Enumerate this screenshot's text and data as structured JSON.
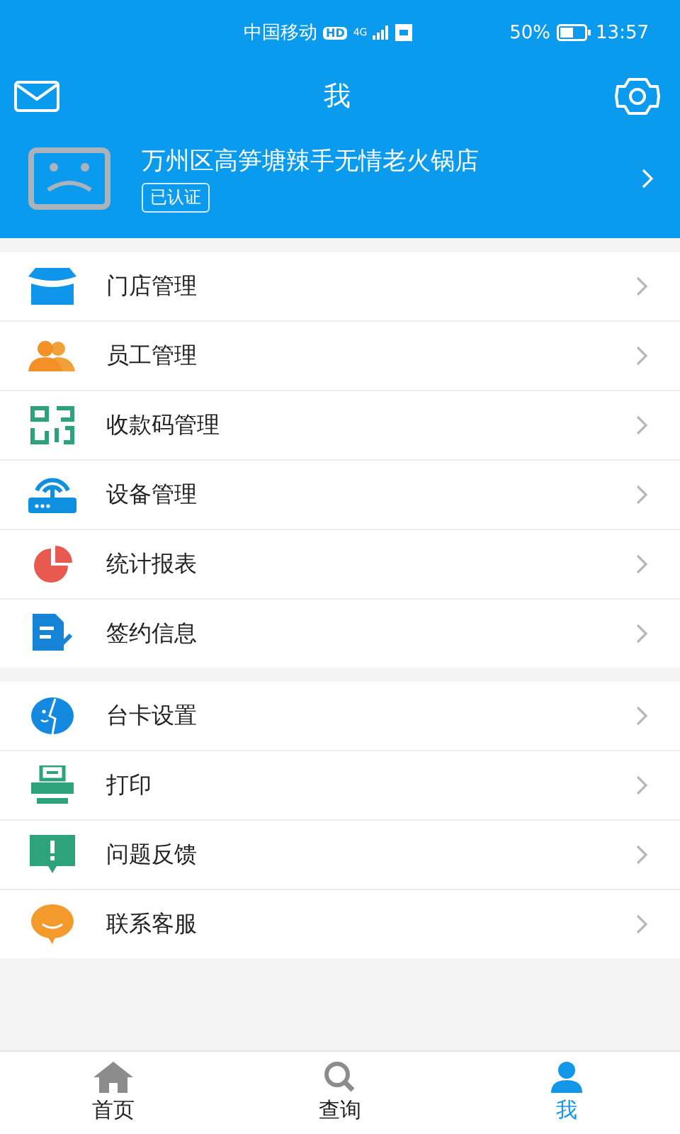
{
  "status_bar": {
    "carrier": "中国移动",
    "hd": "HD",
    "network": "4G",
    "battery": "50%",
    "time": "13:57"
  },
  "header": {
    "title": "我"
  },
  "profile": {
    "name": "万州区高笋塘辣手无情老火锅店",
    "badge": "已认证"
  },
  "menu_groups": [
    {
      "items": [
        {
          "kind": "store",
          "label": "门店管理"
        },
        {
          "kind": "staff",
          "label": "员工管理"
        },
        {
          "kind": "qrcode",
          "label": "收款码管理"
        },
        {
          "kind": "device",
          "label": "设备管理"
        },
        {
          "kind": "chart",
          "label": "统计报表"
        },
        {
          "kind": "contract",
          "label": "签约信息"
        }
      ]
    },
    {
      "items": [
        {
          "kind": "card",
          "label": "台卡设置"
        },
        {
          "kind": "print",
          "label": "打印"
        },
        {
          "kind": "feedback",
          "label": "问题反馈"
        },
        {
          "kind": "service",
          "label": "联系客服"
        }
      ]
    }
  ],
  "tabs": [
    {
      "kind": "home",
      "label": "首页",
      "selected": false
    },
    {
      "kind": "search",
      "label": "查询",
      "selected": false
    },
    {
      "kind": "me",
      "label": "我",
      "selected": true
    }
  ]
}
